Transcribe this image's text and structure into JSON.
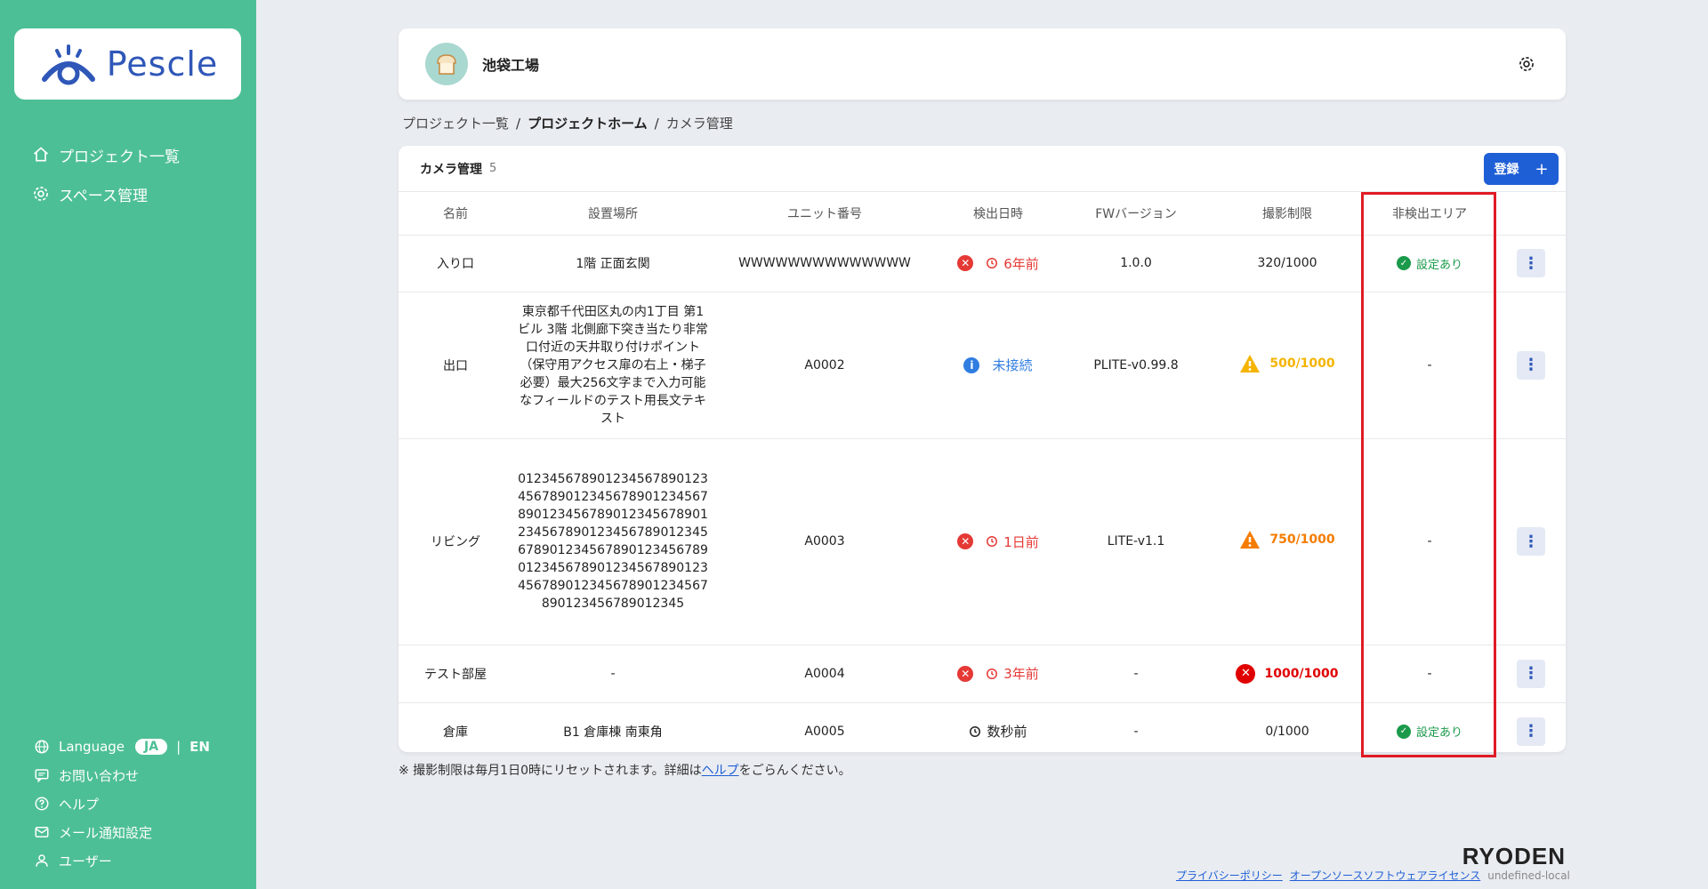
{
  "sidebar": {
    "logo": "Pescle",
    "nav": [
      {
        "label": "プロジェクト一覧",
        "icon": "home-icon"
      },
      {
        "label": "スペース管理",
        "icon": "gear-icon"
      }
    ],
    "language": {
      "label": "Language",
      "ja": "JA",
      "sep": "|",
      "en": "EN"
    },
    "footer": [
      {
        "label": "お問い合わせ",
        "icon": "chat-icon"
      },
      {
        "label": "ヘルプ",
        "icon": "help-icon"
      },
      {
        "label": "メール通知設定",
        "icon": "mail-icon"
      },
      {
        "label": "ユーザー",
        "icon": "user-icon"
      }
    ]
  },
  "header": {
    "project_name": "池袋工場"
  },
  "breadcrumb": {
    "item1": "プロジェクト一覧",
    "sep": "/",
    "item2": "プロジェクトホーム",
    "item3": "カメラ管理"
  },
  "table": {
    "title": "カメラ管理",
    "count": "5",
    "register_label": "登録",
    "register_plus": "+",
    "columns": [
      "名前",
      "設置場所",
      "ユニット番号",
      "検出日時",
      "FWバージョン",
      "撮影制限",
      "非検出エリア"
    ],
    "rows": [
      {
        "name": "入り口",
        "location": "1階 正面玄関",
        "unit": "WWWWWWWWWWWWWW",
        "time": "6年前",
        "fw": "1.0.0",
        "limit": "320/1000",
        "area": "設定あり",
        "menu": "⋮"
      },
      {
        "name": "出口",
        "location": "東京都千代田区丸の内1丁目 第1ビル 3階 北側廊下突き当たり非常口付近の天井取り付けポイント（保守用アクセス扉の右上・梯子必要）最大256文字まで入力可能なフィールドのテスト用長文テキスト",
        "unit": "A0002",
        "time": "未接続",
        "fw": "PLITE-v0.99.8",
        "limit": "500/1000",
        "area": "-",
        "menu": "⋮"
      },
      {
        "name": "リビング",
        "location": "012345678901234567890123456789012345678901234567890123456789012345678901234567890123456789012345678901234567890123456789012345678901234567890123456789012345678901234567890123456789012345",
        "unit": "A0003",
        "time": "1日前",
        "fw": "LITE-v1.1",
        "limit": "750/1000",
        "area": "-",
        "menu": "⋮"
      },
      {
        "name": "テスト部屋",
        "location": "-",
        "unit": "A0004",
        "time": "3年前",
        "fw": "-",
        "limit": "1000/1000",
        "area": "-",
        "menu": "⋮"
      },
      {
        "name": "倉庫",
        "location": "B1 倉庫棟 南東角",
        "unit": "A0005",
        "time": "数秒前",
        "fw": "-",
        "limit": "0/1000",
        "area": "設定あり",
        "menu": "⋮"
      }
    ]
  },
  "note": {
    "prefix": "※ 撮影制限は毎月1日0時にリセットされます。詳細は",
    "link": "ヘルプ",
    "suffix": "をごらんください。"
  },
  "footer": {
    "brand": "RYODEN",
    "privacy": "プライバシーポリシー",
    "oss": "オープンソースソフトウェアライセンス",
    "env": "undefined-local"
  },
  "colors": {
    "sidebar": "#4dbf96",
    "primary": "#1f5fd6",
    "error": "#e53935",
    "warning": "#f5b400",
    "orange": "#f57c00",
    "success": "#1a9a4a",
    "highlight": "#e01b24"
  }
}
